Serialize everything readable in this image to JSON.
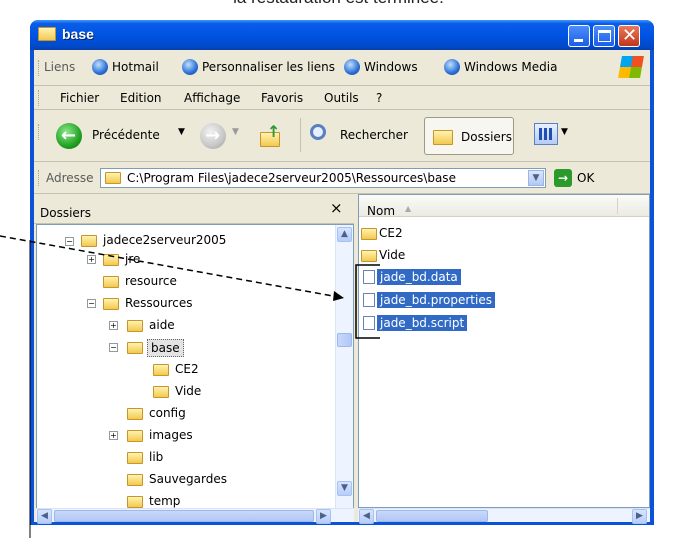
{
  "caption": "la restauration est terminée.",
  "window": {
    "title": "base"
  },
  "links_bar": {
    "label": "Liens",
    "items": [
      "Hotmail",
      "Personnaliser les liens",
      "Windows",
      "Windows Media"
    ]
  },
  "menu": [
    "Fichier",
    "Edition",
    "Affichage",
    "Favoris",
    "Outils",
    "?"
  ],
  "toolbar": {
    "back": "Précédente",
    "search": "Rechercher",
    "folders": "Dossiers"
  },
  "address": {
    "label": "Adresse",
    "value": "C:\\Program Files\\jadece2serveur2005\\Ressources\\base",
    "go": "OK"
  },
  "left_pane": {
    "header": "Dossiers",
    "close": "×",
    "tree": [
      "jadece2serveur2005",
      "jre",
      "resource",
      "Ressources",
      "aide",
      "base",
      "CE2",
      "Vide",
      "config",
      "images",
      "lib",
      "Sauvegardes",
      "temp"
    ]
  },
  "right_pane": {
    "column": "Nom",
    "items": [
      "CE2",
      "Vide",
      "jade_bd.data",
      "jade_bd.properties",
      "jade_bd.script"
    ]
  }
}
